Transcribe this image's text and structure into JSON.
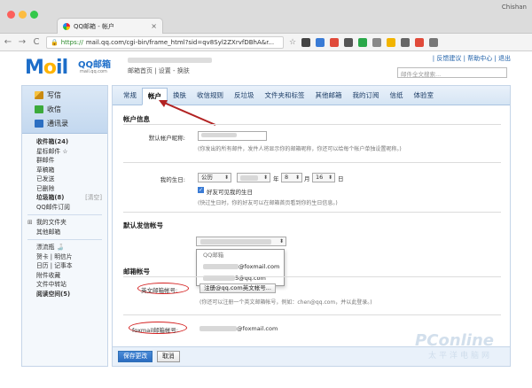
{
  "browser": {
    "tab_title": "QQ邮箱 - 帐户",
    "tab_close": "×",
    "profile_name": "Chishan",
    "url_scheme": "https://",
    "url_rest": "mail.qq.com/cgi-bin/frame_html?sid=qv8Syl2ZXrvfDBhA&r...",
    "back": "←",
    "forward": "→",
    "reload": "C",
    "star": "☆"
  },
  "header": {
    "logo_mail": "M",
    "logo_o": "o",
    "logo_il": "il",
    "logo_cn": "QQ邮箱",
    "logo_sub": "mail.qq.com",
    "links": "邮箱首页 | 设置 - 换肤",
    "toplinks": "| 反馈建议 | 帮助中心 | 退出",
    "search_placeholder": "邮件全文搜索..."
  },
  "sidebar": {
    "compose": "写信",
    "inbox": "收信",
    "contacts": "通讯录",
    "items": [
      {
        "label": "收件箱(24)",
        "bold": true
      },
      {
        "label": "星标邮件 ☆",
        "bold": false
      },
      {
        "label": "群邮件",
        "bold": false
      },
      {
        "label": "草稿箱",
        "bold": false
      },
      {
        "label": "已发送",
        "bold": false
      },
      {
        "label": "已删除",
        "bold": false
      },
      {
        "label": "垃圾箱(8)",
        "bold": true,
        "extra": "[清空]"
      },
      {
        "label": "QQ邮件订阅",
        "bold": false
      }
    ],
    "folders": [
      {
        "label": "我的文件夹",
        "plus": "⊞"
      },
      {
        "label": "其他邮箱"
      }
    ],
    "apps": [
      {
        "label": "漂流瓶 🍶"
      },
      {
        "label": "贺卡 | 明信片"
      },
      {
        "label": "日历 | 记事本"
      },
      {
        "label": "附件收藏"
      },
      {
        "label": "文件中转站"
      },
      {
        "label": "阅读空间(5)",
        "bold": true
      }
    ]
  },
  "settings": {
    "tabs": [
      "常规",
      "帐户",
      "换肤",
      "收信规则",
      "反垃圾",
      "文件夹和标签",
      "其他邮箱",
      "我的订阅",
      "信纸",
      "体验室"
    ],
    "active_tab": 1,
    "account_section": "帐户信息",
    "nickname_label": "默认帐户昵称:",
    "nickname_note": "(你发出的所有邮件，发件人将显示你的邮箱昵称，你还可以给每个帐户单独设置昵称。)",
    "birthday_label": "我的生日:",
    "calendar_type": "公历",
    "year_sep": "年",
    "month": "8",
    "month_sep": "月",
    "day": "16",
    "day_sep": "日",
    "birthday_checkbox": "好友可见我的生日",
    "birthday_note": "(快过生日时，你的好友可以在邮箱首页看到你的生日信息。)",
    "sender_section": "默认发信帐号",
    "dropdown_options": [
      "QQ邮箱",
      "@foxmail.com",
      "5@qq.com"
    ],
    "mailbox_section": "邮箱帐号",
    "english_label": "英文邮箱帐号:",
    "english_button": "注册@qq.com英文帐号...",
    "english_note": "(你还可以注册一个英文邮箱帐号，例如：chen@qq.com，并以此登录。)",
    "foxmail_label": "foxmail邮箱帐号:",
    "foxmail_value": "@foxmail.com",
    "save_button": "保存更改",
    "cancel_button": "取消"
  },
  "watermark": {
    "brand": "PConline",
    "cn": "太平洋电脑网"
  },
  "colors": {
    "accent": "#1d6ec9",
    "tab_bg": "#e9f1fa",
    "annotation": "#d42020"
  }
}
